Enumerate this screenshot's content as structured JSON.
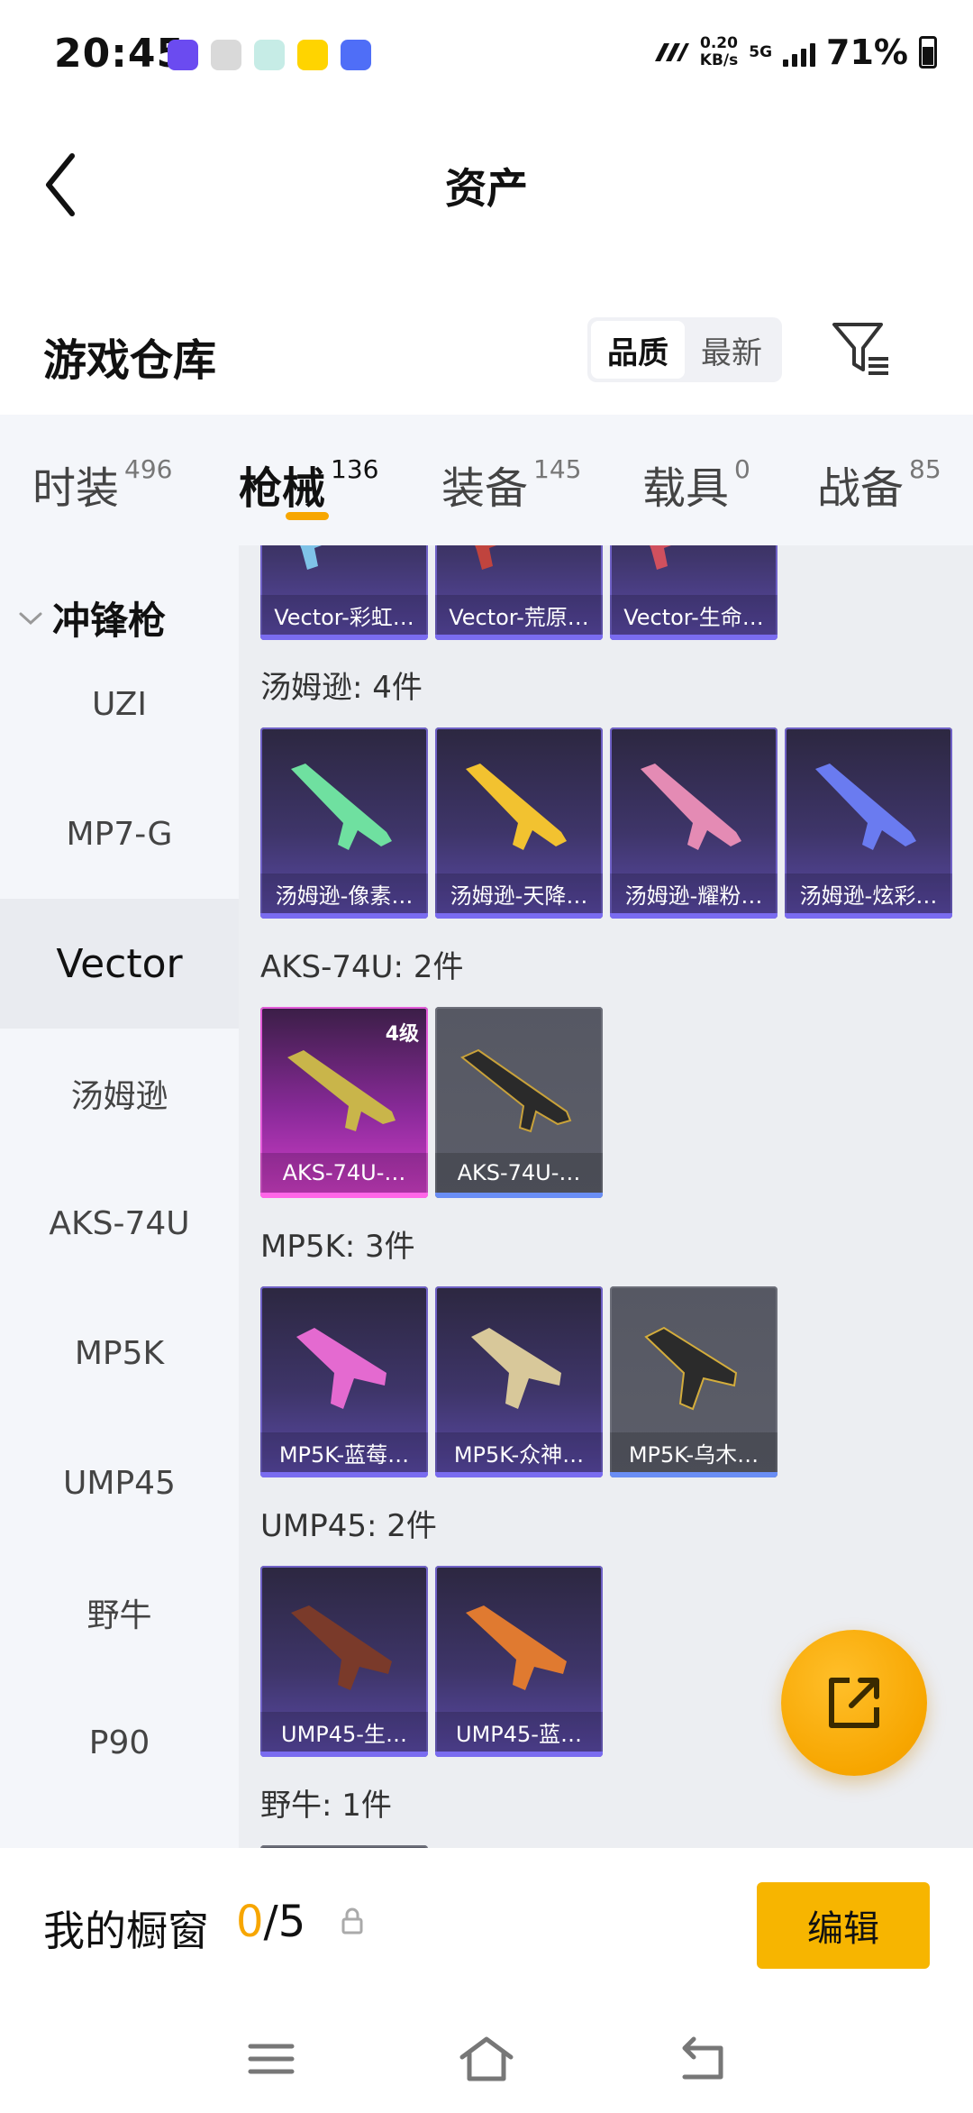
{
  "status_bar": {
    "time": "20:45",
    "net_speed_value": "0.20",
    "net_speed_unit": "KB/s",
    "network": "5G",
    "battery": "71%"
  },
  "header": {
    "title": "资产"
  },
  "warehouse": {
    "title": "游戏仓库",
    "sort_options": [
      "品质",
      "最新"
    ],
    "active_sort": "品质"
  },
  "category_tabs": [
    {
      "label": "时装",
      "count": "496"
    },
    {
      "label": "枪械",
      "count": "136"
    },
    {
      "label": "装备",
      "count": "145"
    },
    {
      "label": "载具",
      "count": "0"
    },
    {
      "label": "战备",
      "count": "85"
    }
  ],
  "sidebar": {
    "group": "冲锋枪",
    "items": [
      "UZI",
      "MP7-G",
      "Vector",
      "汤姆逊",
      "AKS-74U",
      "MP5K",
      "UMP45",
      "野牛",
      "P90"
    ],
    "active": "Vector"
  },
  "sections": {
    "vector_cards": [
      "Vector-彩虹…",
      "Vector-荒原…",
      "Vector-生命…"
    ],
    "thompson": {
      "title": "汤姆逊: 4件",
      "cards": [
        "汤姆逊-像素…",
        "汤姆逊-天降…",
        "汤姆逊-耀粉…",
        "汤姆逊-炫彩…"
      ]
    },
    "aks": {
      "title": "AKS-74U: 2件",
      "cards": [
        "AKS-74U-…",
        "AKS-74U-…"
      ],
      "level_badge": "4级"
    },
    "mp5k": {
      "title": "MP5K: 3件",
      "cards": [
        "MP5K-蓝莓…",
        "MP5K-众神…",
        "MP5K-乌木…"
      ]
    },
    "ump45": {
      "title": "UMP45: 2件",
      "cards": [
        "UMP45-生…",
        "UMP45-蓝…"
      ]
    },
    "bison": {
      "title": "野牛: 1件"
    }
  },
  "window_bar": {
    "title": "我的橱窗",
    "current": "0",
    "total": "/5",
    "edit_label": "编辑"
  },
  "colors": {
    "accent": "#f7a600",
    "card_purple": "#3e3569",
    "card_gray": "#5c5e69",
    "card_pink": "#d33fc9"
  },
  "icons": [
    "back-arrow-icon",
    "filter-icon",
    "share-icon",
    "lock-icon",
    "menu-icon",
    "home-icon",
    "return-icon"
  ]
}
